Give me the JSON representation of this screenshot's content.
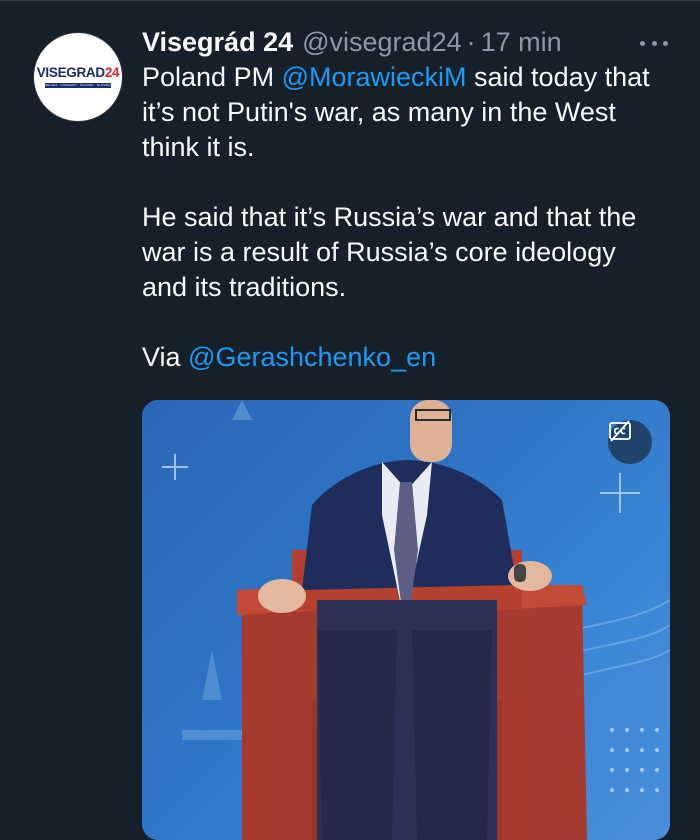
{
  "tweet": {
    "avatar_logo_main": "VISEGRAD",
    "avatar_logo_accent": "24",
    "avatar_logo_strip": "CZECHIA · HUNGARY · POLAND · SLOVAKIA",
    "display_name": "Visegrád 24",
    "handle": "@visegrad24",
    "separator": "·",
    "time": "17 min",
    "line1_prefix": "Poland PM ",
    "mention1": "@MorawieckiM",
    "line1_suffix": " said today that",
    "line2": "it’s not Putin's war, as many in the West",
    "line3": "think it is.",
    "line4": "He said that it’s Russia’s war and that the",
    "line5": "war is a result of Russia’s core ideology",
    "line6": "and its traditions.",
    "via_prefix": "Via ",
    "mention2": "@Gerashchenko_en"
  },
  "media": {
    "type": "video",
    "cc_icon": "closed-captions-off-icon"
  },
  "colors": {
    "background": "#15202b",
    "text": "#f7f9f9",
    "secondary": "#8b98a5",
    "link": "#1d9bf0"
  }
}
